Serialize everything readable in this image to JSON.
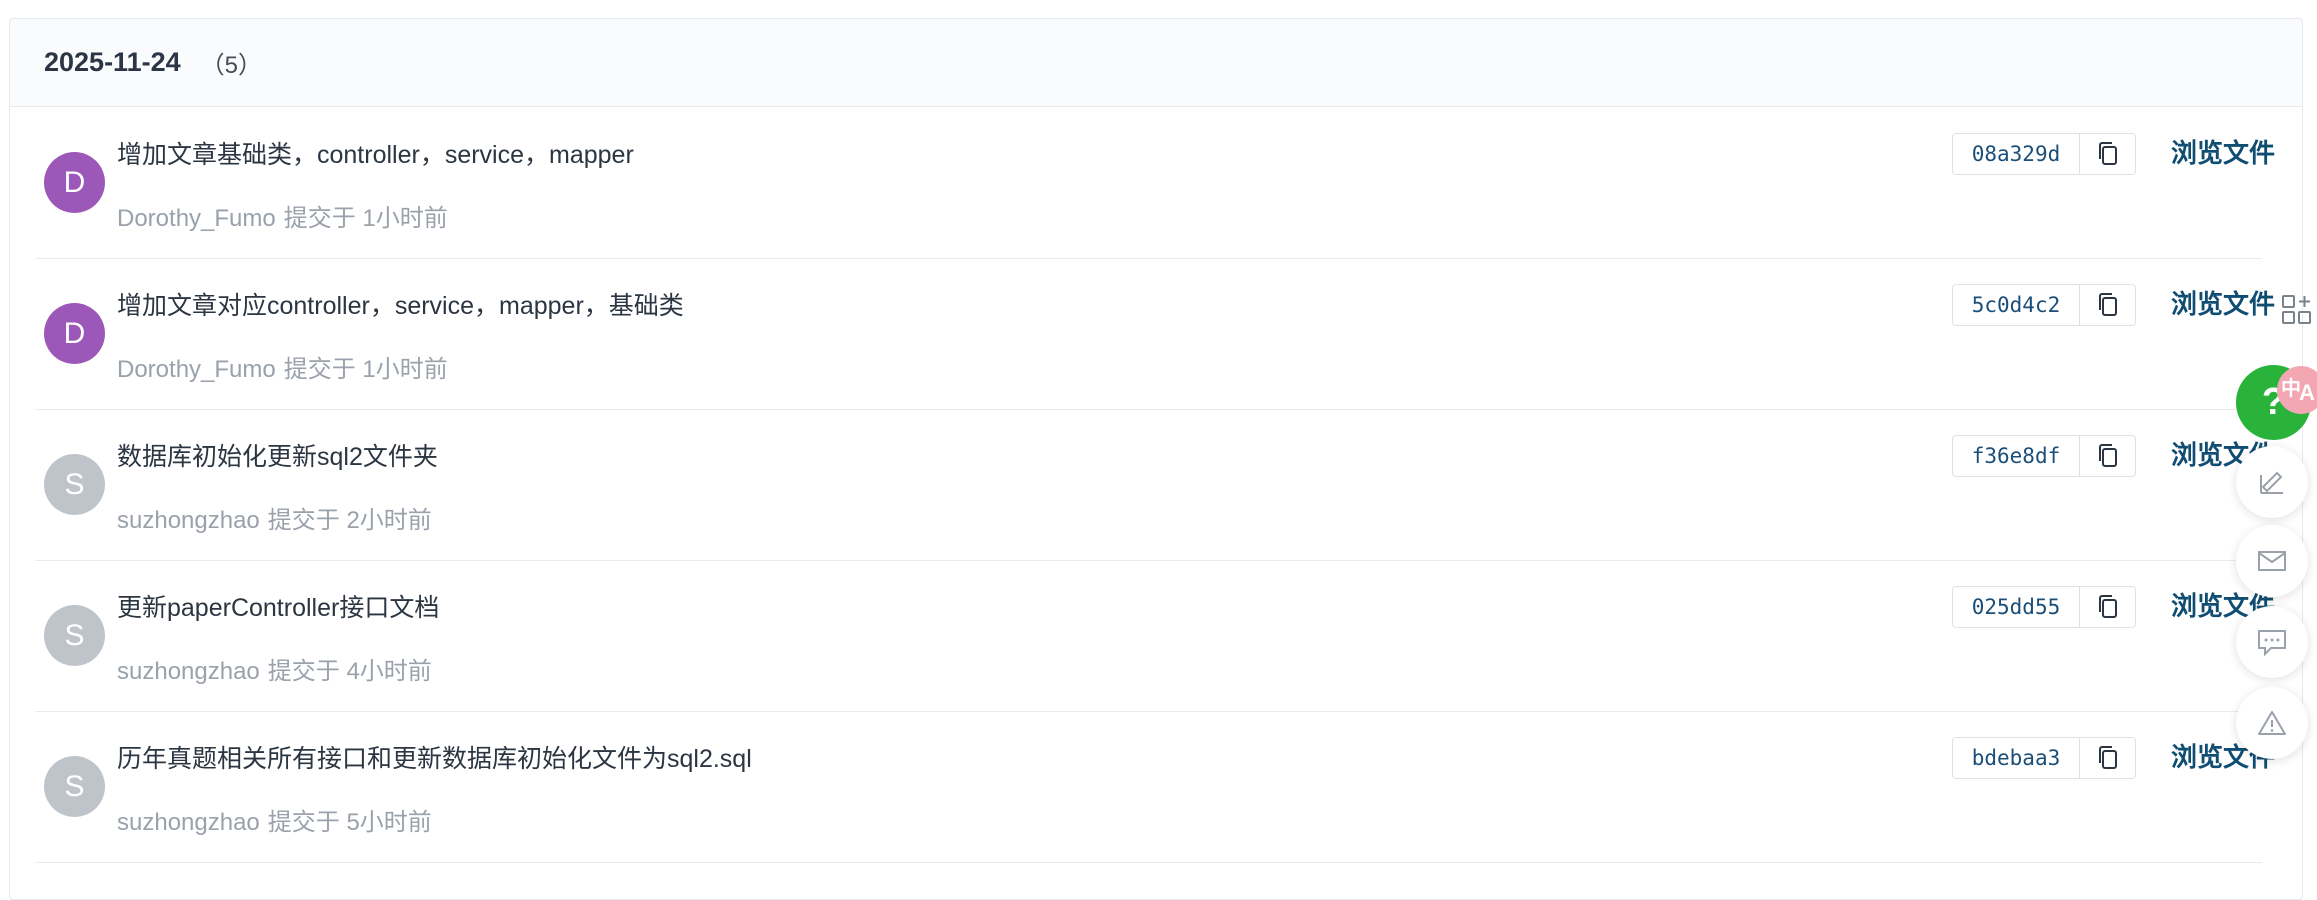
{
  "group": {
    "date": "2025-11-24",
    "count": "（5）"
  },
  "commits": [
    {
      "initial": "D",
      "avatar_color": "#9c58b8",
      "message": "增加文章基础类，controller，service，mapper",
      "author": "Dorothy_Fumo",
      "time_text": "提交于 1小时前",
      "sha": "08a329d",
      "browse_label": "浏览文件"
    },
    {
      "initial": "D",
      "avatar_color": "#9c58b8",
      "message": "增加文章对应controller，service，mapper，基础类",
      "author": "Dorothy_Fumo",
      "time_text": "提交于 1小时前",
      "sha": "5c0d4c2",
      "browse_label": "浏览文件"
    },
    {
      "initial": "S",
      "avatar_color": "#bfc4ca",
      "message": "数据库初始化更新sql2文件夹",
      "author": "suzhongzhao",
      "time_text": "提交于 2小时前",
      "sha": "f36e8df",
      "browse_label": "浏览文件"
    },
    {
      "initial": "S",
      "avatar_color": "#bfc4ca",
      "message": "更新paperController接口文档",
      "author": "suzhongzhao",
      "time_text": "提交于 4小时前",
      "sha": "025dd55",
      "browse_label": "浏览文件"
    },
    {
      "initial": "S",
      "avatar_color": "#bfc4ca",
      "message": "历年真题相关所有接口和更新数据库初始化文件为sql2.sql",
      "author": "suzhongzhao",
      "time_text": "提交于 5小时前",
      "sha": "bdebaa3",
      "browse_label": "浏览文件"
    }
  ],
  "floating_toolbar": {
    "help_label": "?",
    "lang_badge": {
      "zh": "中",
      "en": "A"
    },
    "icons": [
      "apps-add-icon",
      "edit-icon",
      "mail-icon",
      "comment-icon",
      "warning-icon"
    ]
  }
}
